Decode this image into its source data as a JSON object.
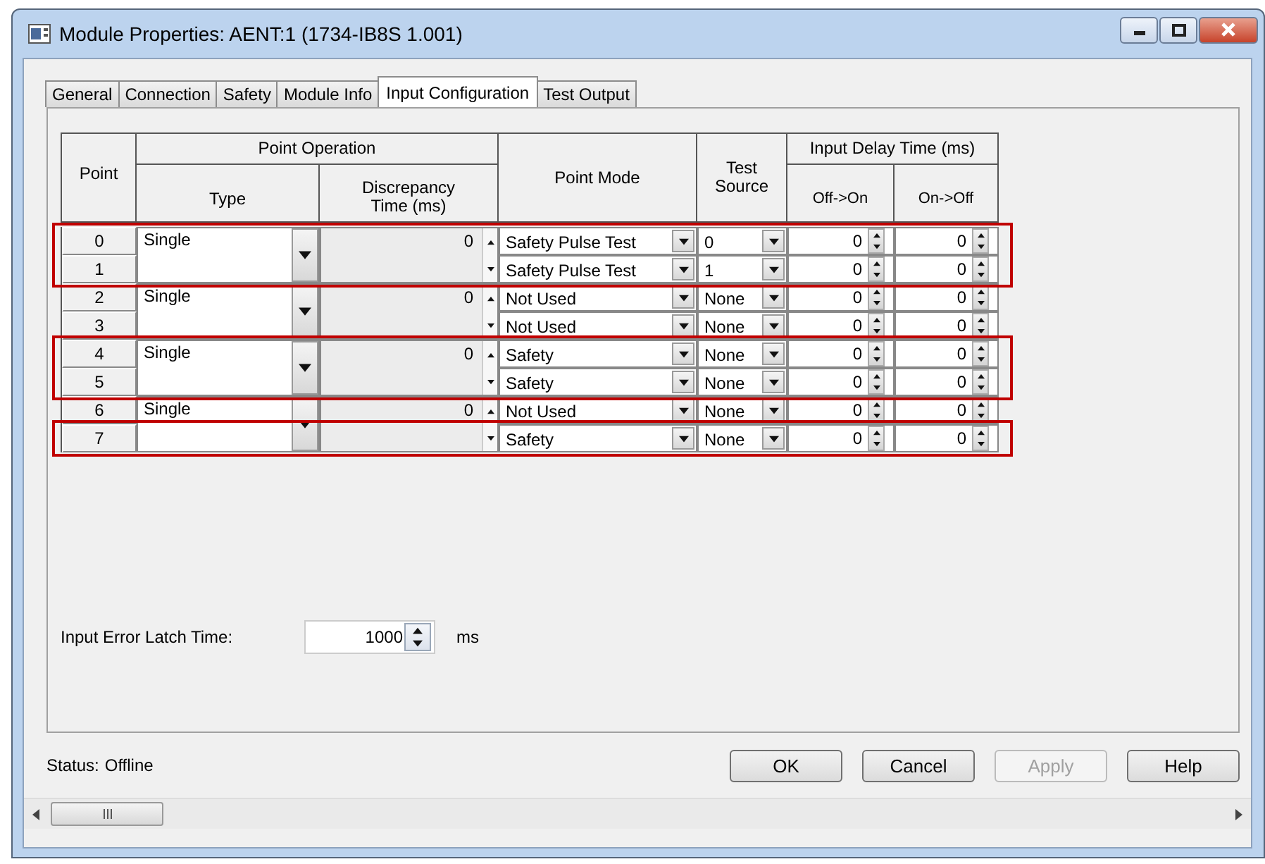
{
  "window": {
    "title": "Module Properties: AENT:1 (1734-IB8S 1.001)"
  },
  "tabs": [
    {
      "label": "General",
      "selected": false
    },
    {
      "label": "Connection",
      "selected": false
    },
    {
      "label": "Safety",
      "selected": false
    },
    {
      "label": "Module Info",
      "selected": false
    },
    {
      "label": "Input Configuration",
      "selected": true
    },
    {
      "label": "Test Output",
      "selected": false
    }
  ],
  "table": {
    "headers": {
      "point": "Point",
      "point_operation": "Point Operation",
      "type": "Type",
      "discrepancy": "Discrepancy Time (ms)",
      "point_mode": "Point Mode",
      "test_source": "Test Source",
      "input_delay": "Input Delay Time (ms)",
      "off_on": "Off->On",
      "on_off": "On->Off"
    },
    "pairs": [
      {
        "type": "Single",
        "discrepancy": "0",
        "points": [
          {
            "point": "0",
            "mode": "Safety Pulse Test",
            "test_source": "0",
            "off_on": "0",
            "on_off": "0",
            "highlighted": true
          },
          {
            "point": "1",
            "mode": "Safety Pulse Test",
            "test_source": "1",
            "off_on": "0",
            "on_off": "0",
            "highlighted": true
          }
        ]
      },
      {
        "type": "Single",
        "discrepancy": "0",
        "points": [
          {
            "point": "2",
            "mode": "Not Used",
            "test_source": "None",
            "off_on": "0",
            "on_off": "0",
            "highlighted": false
          },
          {
            "point": "3",
            "mode": "Not Used",
            "test_source": "None",
            "off_on": "0",
            "on_off": "0",
            "highlighted": false
          }
        ]
      },
      {
        "type": "Single",
        "discrepancy": "0",
        "points": [
          {
            "point": "4",
            "mode": "Safety",
            "test_source": "None",
            "off_on": "0",
            "on_off": "0",
            "highlighted": true
          },
          {
            "point": "5",
            "mode": "Safety",
            "test_source": "None",
            "off_on": "0",
            "on_off": "0",
            "highlighted": true
          }
        ]
      },
      {
        "type": "Single",
        "discrepancy": "0",
        "points": [
          {
            "point": "6",
            "mode": "Not Used",
            "test_source": "None",
            "off_on": "0",
            "on_off": "0",
            "highlighted": false
          },
          {
            "point": "7",
            "mode": "Safety",
            "test_source": "None",
            "off_on": "0",
            "on_off": "0",
            "highlighted": true
          }
        ]
      }
    ]
  },
  "latch": {
    "label": "Input Error Latch Time:",
    "value": "1000",
    "unit": "ms"
  },
  "status": {
    "label": "Status:",
    "value": "Offline"
  },
  "buttons": [
    {
      "label": "OK",
      "disabled": false
    },
    {
      "label": "Cancel",
      "disabled": false
    },
    {
      "label": "Apply",
      "disabled": true
    },
    {
      "label": "Help",
      "disabled": false
    }
  ]
}
